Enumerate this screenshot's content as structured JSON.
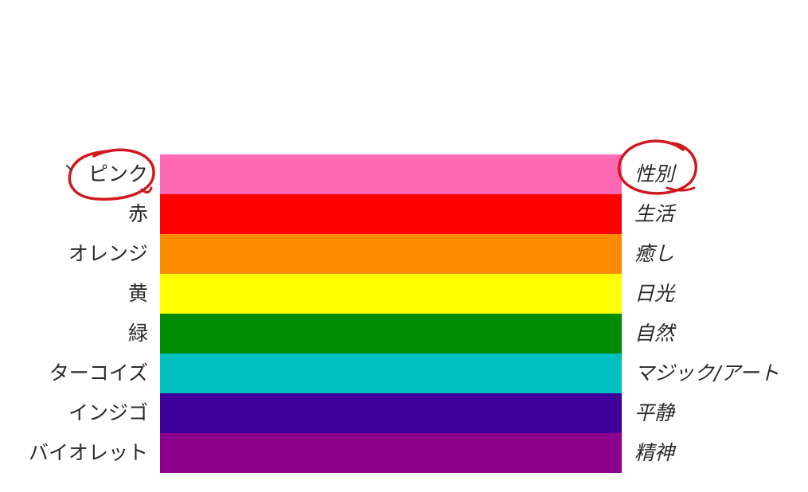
{
  "rows": [
    {
      "color_name": "ピンク",
      "meaning": "性別",
      "hex": "#FF69B4"
    },
    {
      "color_name": "赤",
      "meaning": "生活",
      "hex": "#FF0000"
    },
    {
      "color_name": "オレンジ",
      "meaning": "癒し",
      "hex": "#FF8C00"
    },
    {
      "color_name": "黄",
      "meaning": "日光",
      "hex": "#FFFF00"
    },
    {
      "color_name": "緑",
      "meaning": "自然",
      "hex": "#008C00"
    },
    {
      "color_name": "ターコイズ",
      "meaning": "マジック/アート",
      "hex": "#00C0C0"
    },
    {
      "color_name": "インジゴ",
      "meaning": "平静",
      "hex": "#3E0099"
    },
    {
      "color_name": "バイオレット",
      "meaning": "精神",
      "hex": "#8C008C"
    }
  ],
  "annotation_color": "#D0191E"
}
